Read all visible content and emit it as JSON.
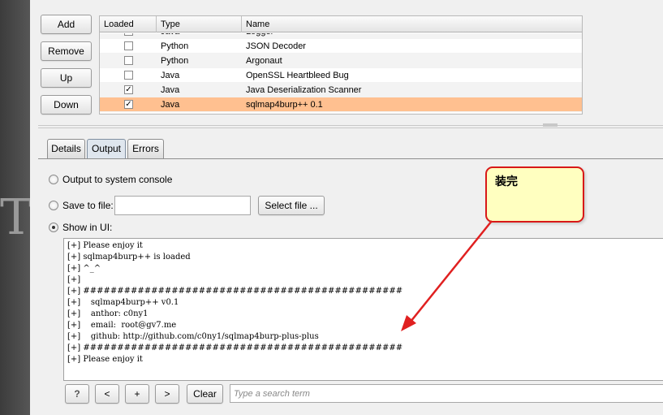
{
  "extension_buttons": {
    "add": "Add",
    "remove": "Remove",
    "up": "Up",
    "down": "Down"
  },
  "extensions_table": {
    "columns": [
      "Loaded",
      "Type",
      "Name"
    ],
    "rows": [
      {
        "loaded": true,
        "type": "Java",
        "name": "Logger++"
      },
      {
        "loaded": false,
        "type": "Python",
        "name": "JSON Decoder"
      },
      {
        "loaded": false,
        "type": "Python",
        "name": "Argonaut"
      },
      {
        "loaded": false,
        "type": "Java",
        "name": "OpenSSL Heartbleed Bug"
      },
      {
        "loaded": true,
        "type": "Java",
        "name": "Java Deserialization Scanner"
      },
      {
        "loaded": true,
        "type": "Java",
        "name": "sqlmap4burp++ 0.1",
        "selected": true
      }
    ]
  },
  "tabs": [
    {
      "label": "Details"
    },
    {
      "label": "Output",
      "active": true
    },
    {
      "label": "Errors"
    }
  ],
  "output": {
    "option_console": "Output to system console",
    "option_file": "Save to file:",
    "option_ui": "Show in UI:",
    "file_value": "",
    "select_file": "Select file ...",
    "selected_option": "ui"
  },
  "console_lines": [
    "[+] Please enjoy it",
    "[+] sqlmap4burp++ is loaded",
    "[+] ^_^",
    "[+]",
    "[+] ###############################################",
    "[+]    sqlmap4burp++ v0.1",
    "[+]    anthor: c0ny1",
    "[+]    email:  root@gv7.me",
    "[+]    github: http://github.com/c0ny1/sqlmap4burp-plus-plus",
    "[+] ###############################################",
    "[+] Please enjoy it"
  ],
  "bottom_toolbar": {
    "help": "?",
    "prev": "<",
    "add": "+",
    "next": ">",
    "clear": "Clear",
    "search_placeholder": "Type a search term"
  },
  "callout": {
    "text": "装完"
  },
  "decor": {
    "letter": "T"
  },
  "colors": {
    "selected_row": "#ffc090",
    "callout_fill": "#ffffc0",
    "callout_border": "#d81818",
    "arrow": "#e02020"
  }
}
